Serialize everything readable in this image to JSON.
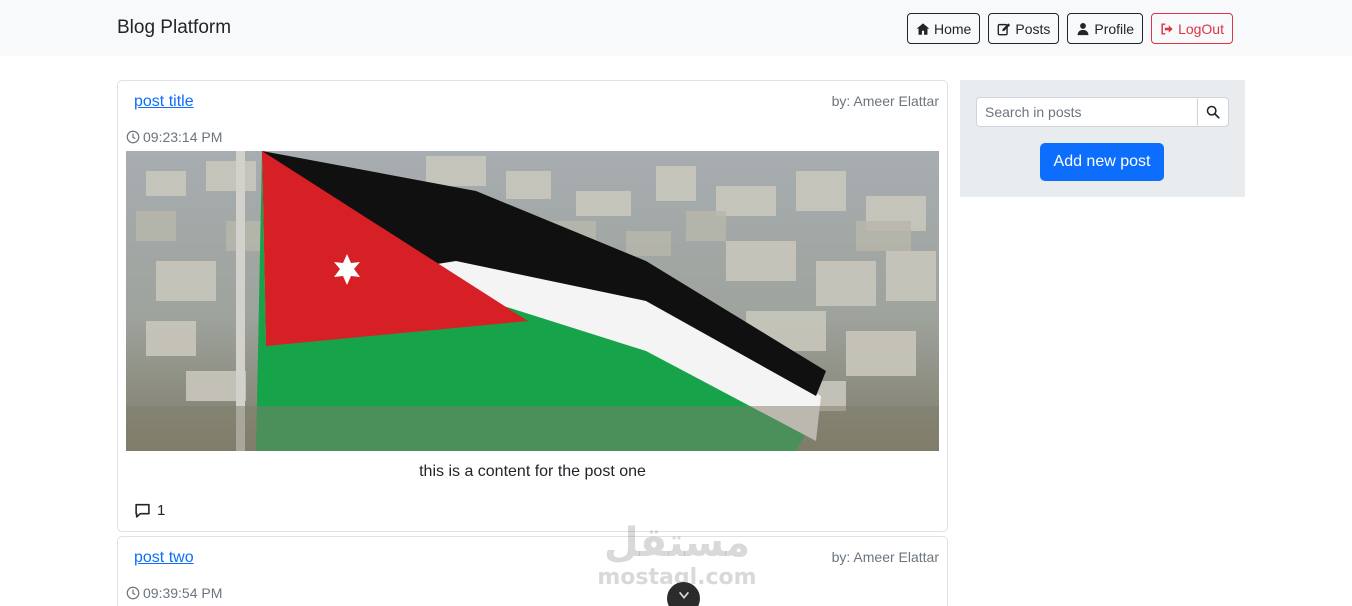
{
  "navbar": {
    "brand": "Blog Platform",
    "buttons": [
      {
        "label": "Home",
        "icon": "home-icon"
      },
      {
        "label": "Posts",
        "icon": "edit-icon"
      },
      {
        "label": "Profile",
        "icon": "user-icon"
      },
      {
        "label": "LogOut",
        "icon": "sign-out-icon"
      }
    ]
  },
  "posts": [
    {
      "title": "post title",
      "author": "by: Ameer Elattar",
      "time": "09:23:14 PM",
      "content": "this is a content for the post one",
      "comments": "1",
      "image": "jordan-flag-photo"
    },
    {
      "title": "post two",
      "author": "by: Ameer Elattar",
      "time": "09:39:54 PM"
    }
  ],
  "sidebar": {
    "search_placeholder": "Search in posts",
    "add_button": "Add new post"
  },
  "watermark": {
    "arabic": "مستقل",
    "latin": "mostaql.com"
  },
  "colors": {
    "primary": "#0d6efd",
    "danger": "#dc3545",
    "navbar_bg": "#f8f9fa",
    "sidebar_bg": "#e9ecef"
  }
}
